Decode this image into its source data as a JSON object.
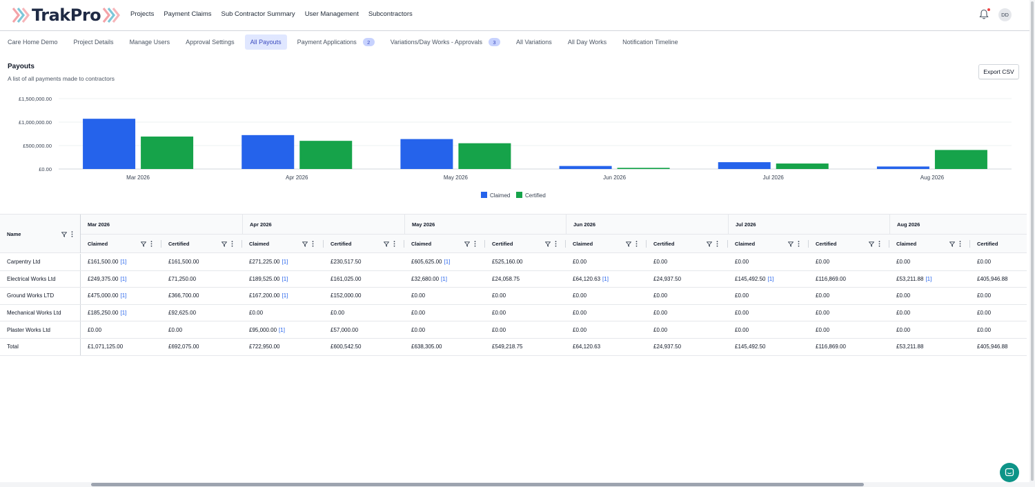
{
  "app": {
    "logo_text": "TrakPro",
    "nav": [
      "Projects",
      "Payment Claims",
      "Sub Contractor Summary",
      "User Management",
      "Subcontractors"
    ],
    "avatar_initials": "DD"
  },
  "tabs": [
    {
      "label": "Care Home Demo",
      "badge": "",
      "active": false
    },
    {
      "label": "Project Details",
      "badge": "",
      "active": false
    },
    {
      "label": "Manage Users",
      "badge": "",
      "active": false
    },
    {
      "label": "Approval Settings",
      "badge": "",
      "active": false
    },
    {
      "label": "All Payouts",
      "badge": "",
      "active": true
    },
    {
      "label": "Payment Applications",
      "badge": "2",
      "active": false
    },
    {
      "label": "Variations/Day Works - Approvals",
      "badge": "3",
      "active": false
    },
    {
      "label": "All Variations",
      "badge": "",
      "active": false
    },
    {
      "label": "All Day Works",
      "badge": "",
      "active": false
    },
    {
      "label": "Notification Timeline",
      "badge": "",
      "active": false
    }
  ],
  "section": {
    "title": "Payouts",
    "subtitle": "A list of all payments made to contractors",
    "export_label": "Export CSV"
  },
  "colors": {
    "claimed": "#2563eb",
    "certified": "#16a34a",
    "accent": "#3b4bbf"
  },
  "chart_data": {
    "type": "bar",
    "categories": [
      "Mar 2026",
      "Apr 2026",
      "May 2026",
      "Jun 2026",
      "Jul 2026",
      "Aug 2026"
    ],
    "series": [
      {
        "name": "Claimed",
        "values": [
          1071125,
          722950,
          638305,
          64120.63,
          145492.5,
          53211.88
        ]
      },
      {
        "name": "Certified",
        "values": [
          692075,
          600542.5,
          549218.75,
          24937.5,
          116869,
          405946.88
        ]
      }
    ],
    "yticks": [
      "£0.00",
      "£500,000.00",
      "£1,000,000.00",
      "£1,500,000.00"
    ],
    "ylim": [
      0,
      1500000
    ],
    "grid": true,
    "legend": "bottom-center"
  },
  "table": {
    "name_header": "Name",
    "months": [
      "Mar 2026",
      "Apr 2026",
      "May 2026",
      "Jun 2026",
      "Jul 2026",
      "Aug 2026"
    ],
    "sub_headers": [
      "Claimed",
      "Certified"
    ],
    "rows": [
      {
        "name": "Carpentry Ltd",
        "cells": [
          [
            "£161,500.00",
            "[1]"
          ],
          [
            "£161,500.00",
            ""
          ],
          [
            "£271,225.00",
            "[1]"
          ],
          [
            "£230,517.50",
            ""
          ],
          [
            "£605,625.00",
            "[1]"
          ],
          [
            "£525,160.00",
            ""
          ],
          [
            "£0.00",
            ""
          ],
          [
            "£0.00",
            ""
          ],
          [
            "£0.00",
            ""
          ],
          [
            "£0.00",
            ""
          ],
          [
            "£0.00",
            ""
          ],
          [
            "£0.00",
            ""
          ]
        ]
      },
      {
        "name": "Electrical Works Ltd",
        "cells": [
          [
            "£249,375.00",
            "[1]"
          ],
          [
            "£71,250.00",
            ""
          ],
          [
            "£189,525.00",
            "[1]"
          ],
          [
            "£161,025.00",
            ""
          ],
          [
            "£32,680.00",
            "[1]"
          ],
          [
            "£24,058.75",
            ""
          ],
          [
            "£64,120.63",
            "[1]"
          ],
          [
            "£24,937.50",
            ""
          ],
          [
            "£145,492.50",
            "[1]"
          ],
          [
            "£116,869.00",
            ""
          ],
          [
            "£53,211.88",
            "[1]"
          ],
          [
            "£405,946.88",
            ""
          ]
        ]
      },
      {
        "name": "Ground Works LTD",
        "cells": [
          [
            "£475,000.00",
            "[1]"
          ],
          [
            "£366,700.00",
            ""
          ],
          [
            "£167,200.00",
            "[1]"
          ],
          [
            "£152,000.00",
            ""
          ],
          [
            "£0.00",
            ""
          ],
          [
            "£0.00",
            ""
          ],
          [
            "£0.00",
            ""
          ],
          [
            "£0.00",
            ""
          ],
          [
            "£0.00",
            ""
          ],
          [
            "£0.00",
            ""
          ],
          [
            "£0.00",
            ""
          ],
          [
            "£0.00",
            ""
          ]
        ]
      },
      {
        "name": "Mechanical Works Ltd",
        "cells": [
          [
            "£185,250.00",
            "[1]"
          ],
          [
            "£92,625.00",
            ""
          ],
          [
            "£0.00",
            ""
          ],
          [
            "£0.00",
            ""
          ],
          [
            "£0.00",
            ""
          ],
          [
            "£0.00",
            ""
          ],
          [
            "£0.00",
            ""
          ],
          [
            "£0.00",
            ""
          ],
          [
            "£0.00",
            ""
          ],
          [
            "£0.00",
            ""
          ],
          [
            "£0.00",
            ""
          ],
          [
            "£0.00",
            ""
          ]
        ]
      },
      {
        "name": "Plaster Works Ltd",
        "cells": [
          [
            "£0.00",
            ""
          ],
          [
            "£0.00",
            ""
          ],
          [
            "£95,000.00",
            "[1]"
          ],
          [
            "£57,000.00",
            ""
          ],
          [
            "£0.00",
            ""
          ],
          [
            "£0.00",
            ""
          ],
          [
            "£0.00",
            ""
          ],
          [
            "£0.00",
            ""
          ],
          [
            "£0.00",
            ""
          ],
          [
            "£0.00",
            ""
          ],
          [
            "£0.00",
            ""
          ],
          [
            "£0.00",
            ""
          ]
        ]
      },
      {
        "name": "Total",
        "cells": [
          [
            "£1,071,125.00",
            ""
          ],
          [
            "£692,075.00",
            ""
          ],
          [
            "£722,950.00",
            ""
          ],
          [
            "£600,542.50",
            ""
          ],
          [
            "£638,305.00",
            ""
          ],
          [
            "£549,218.75",
            ""
          ],
          [
            "£64,120.63",
            ""
          ],
          [
            "£24,937.50",
            ""
          ],
          [
            "£145,492.50",
            ""
          ],
          [
            "£116,869.00",
            ""
          ],
          [
            "£53,211.88",
            ""
          ],
          [
            "£405,946.88",
            ""
          ]
        ]
      }
    ]
  }
}
